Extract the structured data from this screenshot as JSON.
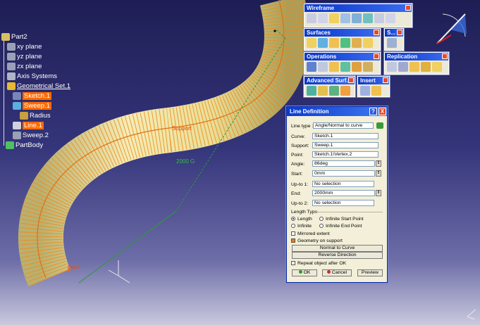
{
  "tree": {
    "part": "Part2",
    "xy_plane": "xy plane",
    "yz_plane": "yz plane",
    "zx_plane": "zx plane",
    "axis_systems": "Axis Systems",
    "geometrical_set": "Geometrical Set.1",
    "sketch": "Sketch.1",
    "sweep1": "Sweep.1",
    "radius": "Radius",
    "line": "Line.1",
    "sweep2": "Sweep.2",
    "partbody": "PartBody"
  },
  "toolbars": {
    "wireframe": "Wireframe",
    "surfaces": "Surfaces",
    "surfaces_short": "S...",
    "operations": "Operations",
    "replication": "Replication",
    "advanced_surfaces": "Advanced Surf...",
    "insert": "Insert"
  },
  "viewport_labels": {
    "support": "Support",
    "dimension": "2000 G",
    "point": "Point"
  },
  "dialog": {
    "title": "Line Definition",
    "help_btn": "?",
    "close_btn": "X",
    "line_type_label": "Line type :",
    "line_type_value": "Angle/Normal to curve",
    "curve_label": "Curve:",
    "curve_value": "Sketch.1",
    "support_label": "Support:",
    "support_value": "Sweep.1",
    "point_label": "Point:",
    "point_value": "Sketch.1\\Vertex.2",
    "angle_label": "Angle:",
    "angle_value": "86deg",
    "start_label": "Start:",
    "start_value": "0mm",
    "upto1_label": "Up-to 1:",
    "upto1_value": "No selection",
    "end_label": "End:",
    "end_value": "2000mm",
    "upto2_label": "Up-to 2:",
    "upto2_value": "No selection",
    "length_type_label": "Length Type",
    "length_opt": "Length",
    "infinite_start_opt": "Infinite Start Point",
    "infinite_opt": "Infinite",
    "infinite_end_opt": "Infinite End Point",
    "mirrored_label": "Mirrored extent",
    "geometry_on_support_label": "Geometry on support",
    "normal_to_curve_btn": "Normal to Curve",
    "reverse_direction_btn": "Reverse Direction",
    "repeat_label": "Repeat object after OK",
    "ok_btn": "OK",
    "cancel_btn": "Cancel",
    "preview_btn": "Preview"
  },
  "colors": {
    "selection": "#ff6a00",
    "tube": "#efe7a6",
    "hatch": "#f08a1a",
    "titlebar": "#0b3bd0"
  }
}
